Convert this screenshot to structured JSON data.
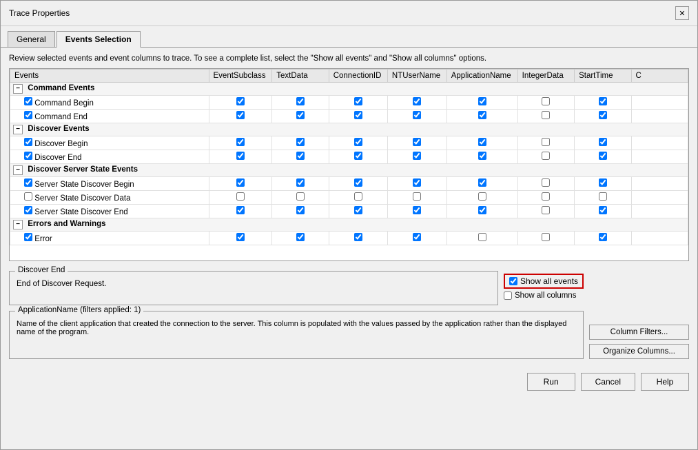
{
  "window": {
    "title": "Trace Properties",
    "close_label": "✕"
  },
  "tabs": [
    {
      "id": "general",
      "label": "General",
      "active": false
    },
    {
      "id": "events-selection",
      "label": "Events Selection",
      "active": true
    }
  ],
  "description": "Review selected events and event columns to trace. To see a complete list, select the \"Show all events\" and \"Show all columns\" options.",
  "table": {
    "columns": [
      "Events",
      "EventSubclass",
      "TextData",
      "ConnectionID",
      "NTUserName",
      "ApplicationName",
      "IntegerData",
      "StartTime",
      "C"
    ],
    "groups": [
      {
        "name": "Command Events",
        "collapsed": false,
        "items": [
          {
            "label": "Command Begin",
            "checks": [
              true,
              true,
              true,
              true,
              true,
              true,
              false,
              true
            ]
          },
          {
            "label": "Command End",
            "checks": [
              true,
              true,
              true,
              true,
              true,
              false,
              false,
              true
            ]
          }
        ]
      },
      {
        "name": "Discover Events",
        "collapsed": false,
        "items": [
          {
            "label": "Discover Begin",
            "checks": [
              true,
              true,
              true,
              true,
              true,
              true,
              false,
              true
            ]
          },
          {
            "label": "Discover End",
            "checks": [
              true,
              true,
              true,
              true,
              true,
              false,
              false,
              true
            ]
          }
        ]
      },
      {
        "name": "Discover Server State Events",
        "collapsed": false,
        "items": [
          {
            "label": "Server State Discover Begin",
            "checks": [
              true,
              true,
              true,
              true,
              true,
              true,
              false,
              true
            ]
          },
          {
            "label": "Server State Discover Data",
            "checks": [
              false,
              false,
              false,
              false,
              false,
              false,
              false,
              false
            ]
          },
          {
            "label": "Server State Discover End",
            "checks": [
              true,
              true,
              true,
              true,
              true,
              true,
              false,
              true
            ]
          }
        ]
      },
      {
        "name": "Errors and Warnings",
        "collapsed": false,
        "items": [
          {
            "label": "Error",
            "checks": [
              true,
              true,
              true,
              true,
              true,
              false,
              false,
              true
            ]
          }
        ]
      }
    ]
  },
  "discover_end_box": {
    "legend": "Discover End",
    "text": "End of Discover Request."
  },
  "show_options": {
    "show_all_events_label": "Show all events",
    "show_all_columns_label": "Show all columns",
    "show_all_events_checked": true,
    "show_all_columns_checked": false
  },
  "appname_box": {
    "legend": "ApplicationName (filters applied: 1)",
    "text": "Name of the client application that created the connection to the server. This column is populated with the values passed by the application rather than the displayed name of the program."
  },
  "side_buttons": {
    "column_filters": "Column Filters...",
    "organize_columns": "Organize Columns..."
  },
  "footer_buttons": {
    "run": "Run",
    "cancel": "Cancel",
    "help": "Help"
  }
}
